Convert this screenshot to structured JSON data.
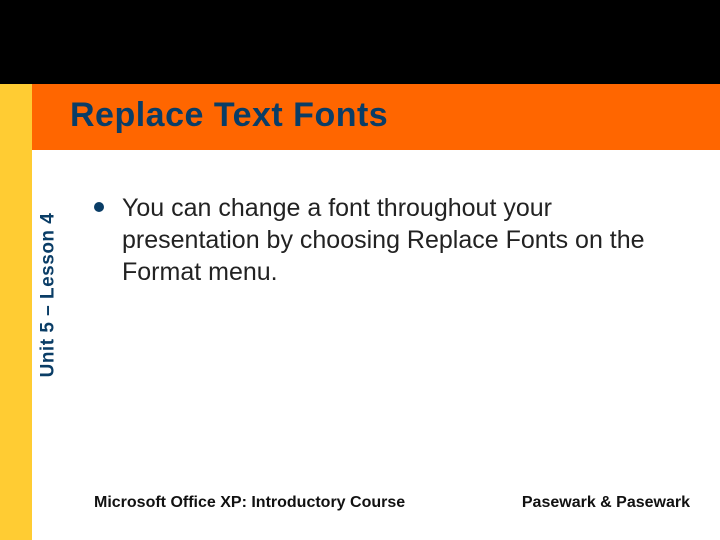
{
  "slide": {
    "title": "Replace Text Fonts",
    "sidebar_label": "Unit 5 – Lesson 4",
    "bullets": [
      "You can change a font throughout your presentation by choosing Replace Fonts on the Format menu."
    ],
    "footer_left": "Microsoft Office XP:  Introductory Course",
    "footer_right": "Pasewark & Pasewark"
  }
}
